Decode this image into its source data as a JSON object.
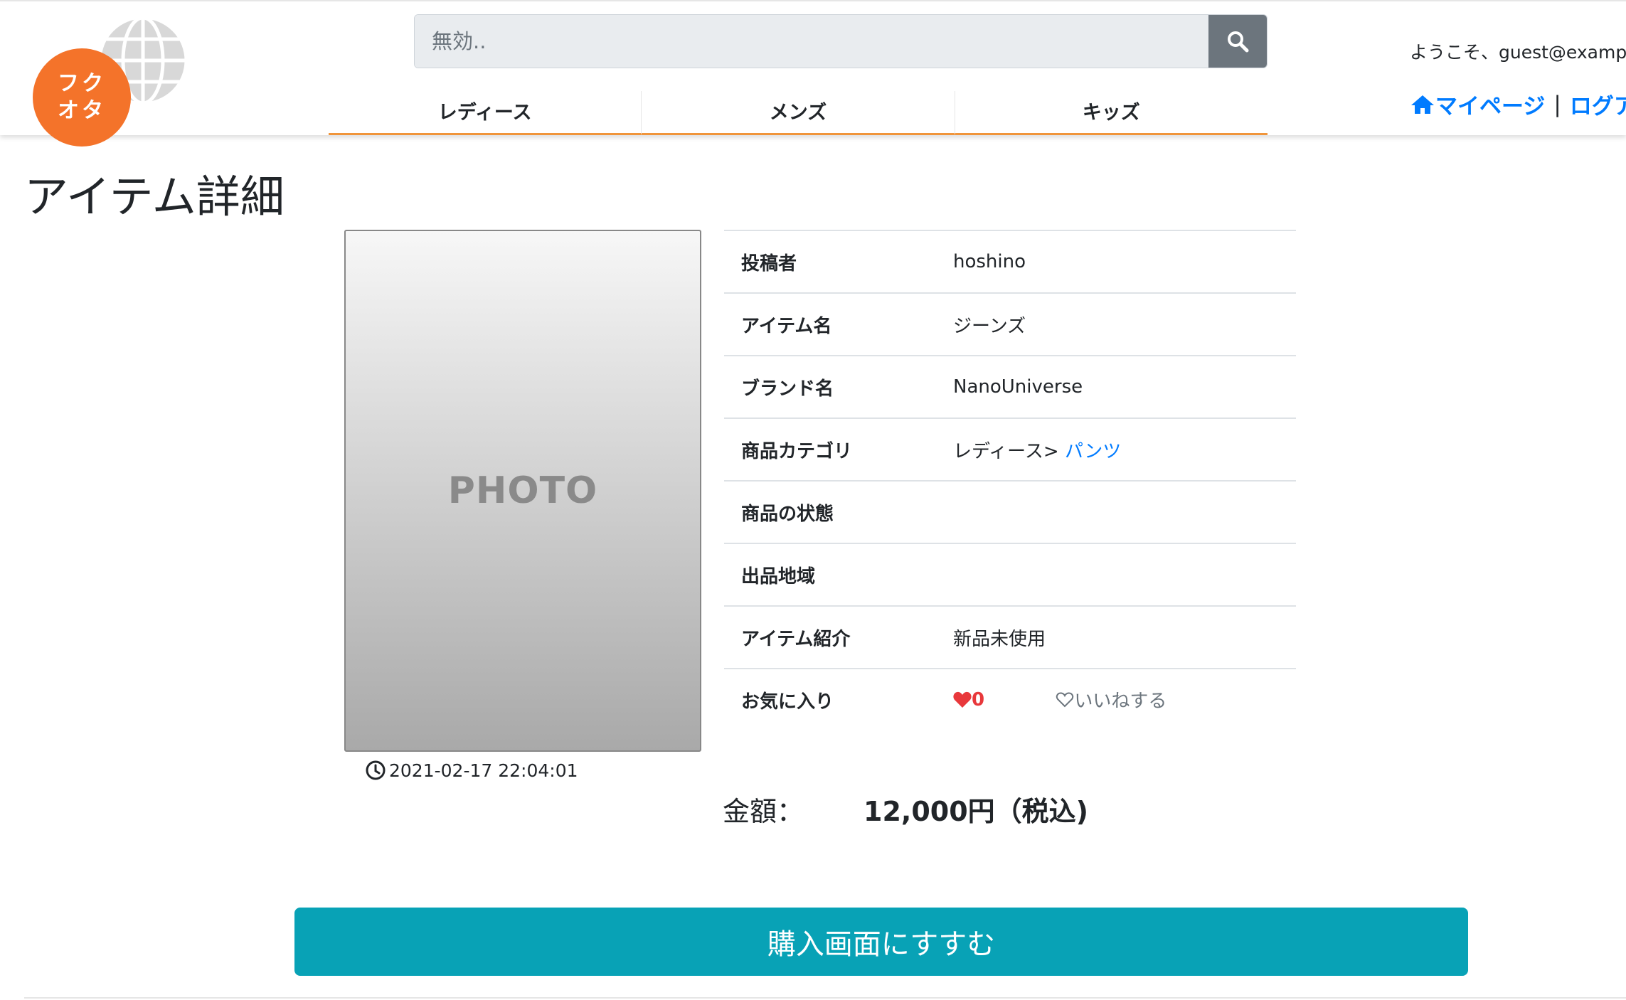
{
  "header": {
    "logo_line1": "フク",
    "logo_line2": "オタ",
    "search_placeholder": "無効..",
    "search_icon": "search-icon",
    "nav": [
      {
        "label": "レディース"
      },
      {
        "label": "メンズ"
      },
      {
        "label": "キッズ"
      }
    ],
    "welcome": "ようこそ、guest@examp",
    "mypage_label": "マイページ",
    "separator": "|",
    "logout_label": "ログア"
  },
  "page": {
    "title": "アイテム詳細",
    "photo_label": "PHOTO",
    "timestamp": "2021-02-17 22:04:01"
  },
  "details": {
    "poster_key": "投稿者",
    "poster_value": "hoshino",
    "item_name_key": "アイテム名",
    "item_name_value": "ジーンズ",
    "brand_key": "ブランド名",
    "brand_value": "NanoUniverse",
    "category_key": "商品カテゴリ",
    "category_parent": "レディース>",
    "category_child": "パンツ",
    "condition_key": "商品の状態",
    "condition_value": "",
    "region_key": "出品地域",
    "region_value": "",
    "intro_key": "アイテム紹介",
    "intro_value": "新品未使用",
    "favorite_key": "お気に入り",
    "favorite_count": "0",
    "like_label": "いいねする"
  },
  "price": {
    "label": "金額：",
    "value": "12,000円（税込)"
  },
  "buy_button": "購入画面にすすむ",
  "colors": {
    "logo_orange": "#f4732a",
    "nav_underline": "#f0953b",
    "link_blue": "#007bff",
    "buy_button": "#08a2b6",
    "heart_red": "#e8383b"
  }
}
